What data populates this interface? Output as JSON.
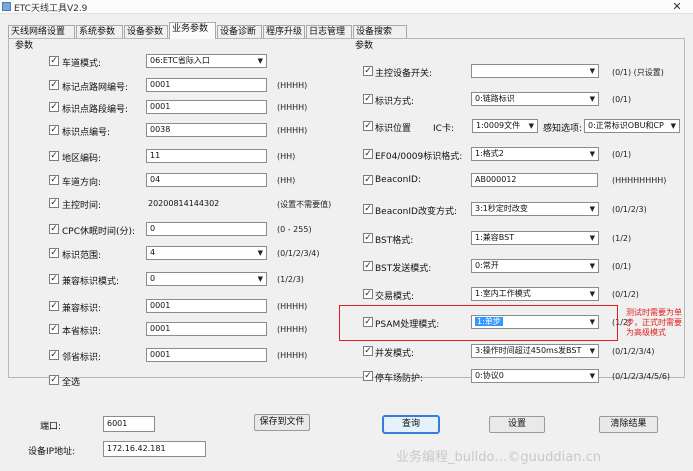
{
  "window": {
    "title": "ETC天线工具V2.9",
    "close": "✕"
  },
  "tabs": [
    "天线网络设置",
    "系统参数",
    "设备参数",
    "业务参数",
    "设备诊断",
    "程序升级",
    "日志管理",
    "设备搜索"
  ],
  "active_tab": "业务参数",
  "left_group": {
    "title": "参数",
    "rows": [
      {
        "label": "车道模式:",
        "checked": true,
        "type": "select",
        "value": "06:ETC省际入口",
        "hint": ""
      },
      {
        "label": "标记点路网编号:",
        "checked": true,
        "type": "text",
        "value": "0001",
        "hint": "(HHHH)"
      },
      {
        "label": "标识点路段编号:",
        "checked": true,
        "type": "text",
        "value": "0001",
        "hint": "(HHHH)"
      },
      {
        "label": "标识点编号:",
        "checked": true,
        "type": "text",
        "value": "0038",
        "hint": "(HHHH)"
      },
      {
        "label": "地区编码:",
        "checked": true,
        "type": "text",
        "value": "11",
        "hint": "(HH)"
      },
      {
        "label": "车道方向:",
        "checked": true,
        "type": "text",
        "value": "04",
        "hint": "(HH)"
      },
      {
        "label": "主控时间:",
        "checked": true,
        "type": "plain",
        "value": "20200814144302",
        "hint": "(设置不需要值)"
      },
      {
        "label": "CPC休眠时间(分):",
        "checked": true,
        "type": "text",
        "value": "0",
        "hint": "(0 - 255)"
      },
      {
        "label": "标识范围:",
        "checked": true,
        "type": "select",
        "value": "4",
        "hint": "(0/1/2/3/4)"
      },
      {
        "label": "兼容标识模式:",
        "checked": true,
        "type": "select",
        "value": "0",
        "hint": "(1/2/3)"
      },
      {
        "label": "兼容标识:",
        "checked": true,
        "type": "text",
        "value": "0001",
        "hint": "(HHHH)"
      },
      {
        "label": "本省标识:",
        "checked": true,
        "type": "text",
        "value": "0001",
        "hint": "(HHHH)"
      },
      {
        "label": "邻省标识:",
        "checked": true,
        "type": "text",
        "value": "0001",
        "hint": "(HHHH)"
      },
      {
        "label": "全选",
        "checked": true,
        "type": "none",
        "value": "",
        "hint": ""
      }
    ]
  },
  "right_group": {
    "title": "参数",
    "rows": [
      {
        "label": "主控设备开关:",
        "checked": true,
        "type": "select",
        "value": "",
        "hint": "(0/1) (只设置)"
      },
      {
        "label": "标识方式:",
        "checked": true,
        "type": "select",
        "value": "0:链路标识",
        "hint": "(0/1)"
      },
      {
        "label": "标识位置",
        "checked": true,
        "type": "multi",
        "hint": ""
      },
      {
        "label": "EF04/0009标识格式:",
        "checked": true,
        "type": "select",
        "value": "1:格式2",
        "hint": "(0/1)"
      },
      {
        "label": "BeaconID:",
        "checked": true,
        "type": "text",
        "value": "AB000012",
        "hint": "(HHHHHHHH)"
      },
      {
        "label": "BeaconID改变方式:",
        "checked": true,
        "type": "select",
        "value": "3:1秒定时改变",
        "hint": "(0/1/2/3)"
      },
      {
        "label": "BST格式:",
        "checked": true,
        "type": "select",
        "value": "1:兼容BST",
        "hint": "(1/2)"
      },
      {
        "label": "BST发送模式:",
        "checked": true,
        "type": "select",
        "value": "0:常开",
        "hint": "(0/1)"
      },
      {
        "label": "交易模式:",
        "checked": true,
        "type": "select",
        "value": "1:室内工作模式",
        "hint": "(0/1/2)"
      },
      {
        "label": "PSAM处理模式:",
        "checked": true,
        "type": "select",
        "value": "1:单步",
        "hint": "(1/2)"
      },
      {
        "label": "并发模式:",
        "checked": true,
        "type": "select",
        "value": "3:操作时间超过450ms发BST",
        "hint": "(0/1/2/3/4)"
      },
      {
        "label": "停车场防护:",
        "checked": true,
        "type": "select",
        "value": "0:协议0",
        "hint": "(0/1/2/3/4/5/6)"
      }
    ],
    "position_row": {
      "card_label": "IC卡:",
      "card_value": "1:0009文件",
      "sense_label": "感知选项:",
      "sense_value": "0:正常标识OBU和CP"
    }
  },
  "annotation": "测试时需要为单步，正式时需要为高级模式",
  "bottom": {
    "port_label": "端口:",
    "port_value": "6001",
    "ip_label": "设备IP地址:",
    "ip_value": "172.16.42.181",
    "save_file": "保存到文件",
    "query": "查询",
    "set": "设置",
    "clear": "清除结果"
  },
  "watermark": "业务编程_bulldo…©guuddian.cn"
}
